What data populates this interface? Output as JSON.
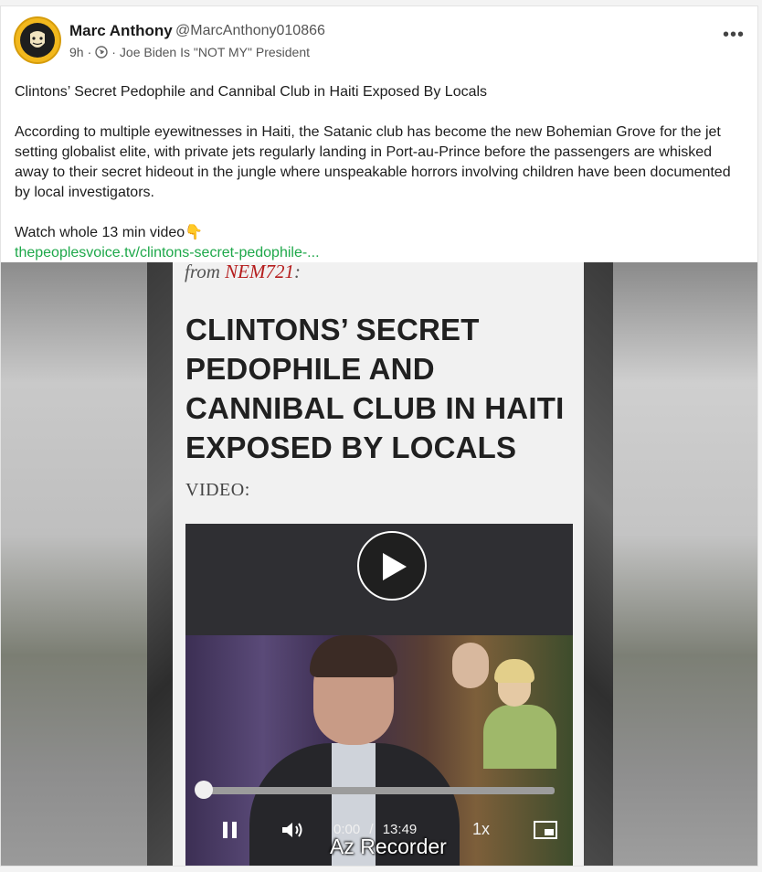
{
  "post": {
    "author_name": "Marc Anthony",
    "author_handle": "@MarcAnthony010866",
    "time_ago": "9h",
    "group": "Joe Biden Is \"NOT MY\" President",
    "title_line": "Clintons’ Secret Pedophile and Cannibal Club in Haiti Exposed By Locals",
    "body_line": "According to multiple eyewitnesses in Haiti, the Satanic club has become the new Bohemian Grove for the jet setting globalist elite, with private jets regularly landing in Port-au-Prince before the passengers are whisked away to their secret hideout in the jungle where unspeakable horrors involving children have been documented by local investigators.",
    "watch_line": "Watch whole 13 min video👇",
    "link_text": "thepeoplesvoice.tv/clintons-secret-pedophile-..."
  },
  "video": {
    "from_prefix": "from ",
    "from_source": "NEM721",
    "from_suffix": ":",
    "headline": "CLINTONS’ SECRET PEDOPHILE AND CANNIBAL CLUB IN HAITI EXPOSED BY LOCALS",
    "video_label": "VIDEO:",
    "current_time": "0:00",
    "time_separator": "/",
    "duration": "13:49",
    "progress_percent": 0,
    "playback_rate": "1x",
    "watermark": "Az Recorder"
  },
  "icons": {
    "more": "more-options-icon",
    "globe": "globe-icon",
    "play": "play-icon",
    "pause": "pause-icon",
    "volume": "volume-icon",
    "pip": "picture-in-picture-icon"
  },
  "colors": {
    "link": "#1ea84a",
    "source_red": "#b51d1d",
    "avatar_gold": "#f2b81d"
  }
}
